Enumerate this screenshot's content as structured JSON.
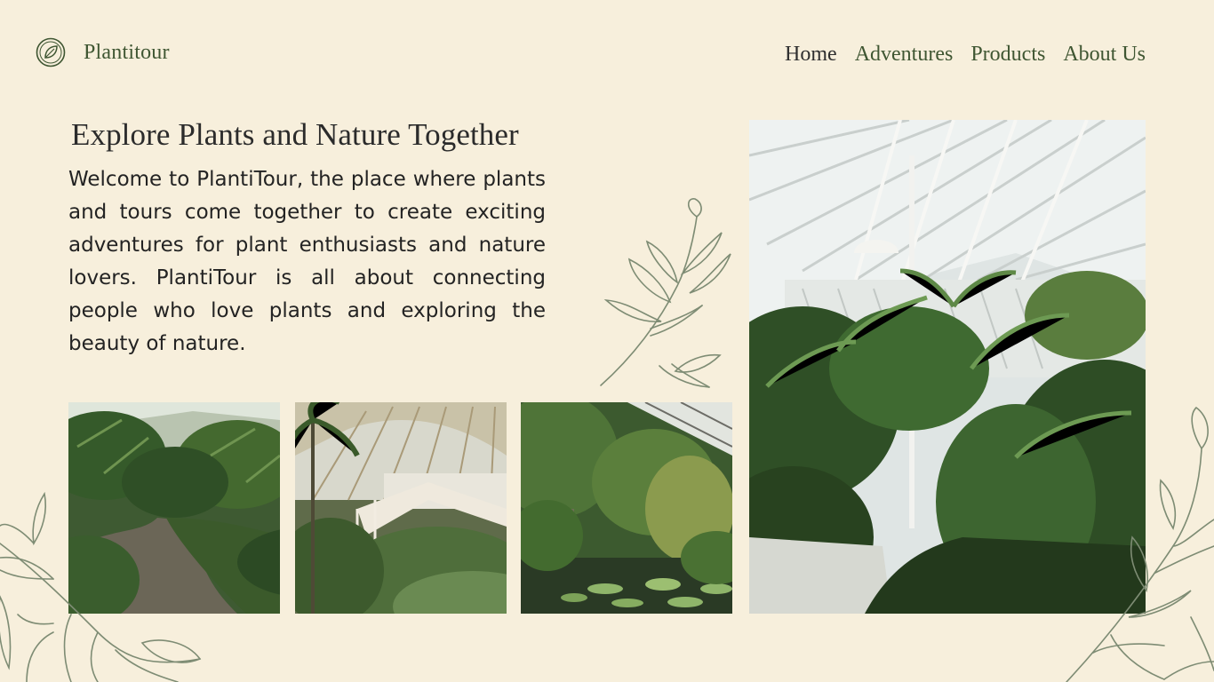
{
  "brand": {
    "name": "Plantitour",
    "icon": "leaf-circle-icon"
  },
  "nav": {
    "items": [
      {
        "label": "Home",
        "active": true
      },
      {
        "label": "Adventures"
      },
      {
        "label": "Products"
      },
      {
        "label": "About Us"
      }
    ]
  },
  "hero": {
    "title": "Explore Plants and Nature Together",
    "text": "Welcome to PlantiTour, the place where plants and tours come together to create exciting adventures for plant enthusiasts and nature lovers. PlantiTour is all about connecting people who love plants and exploring the beauty of nature."
  },
  "colors": {
    "background": "#f7efdc",
    "brand_green": "#3f5632",
    "leaf_outline": "#7e8c74"
  }
}
